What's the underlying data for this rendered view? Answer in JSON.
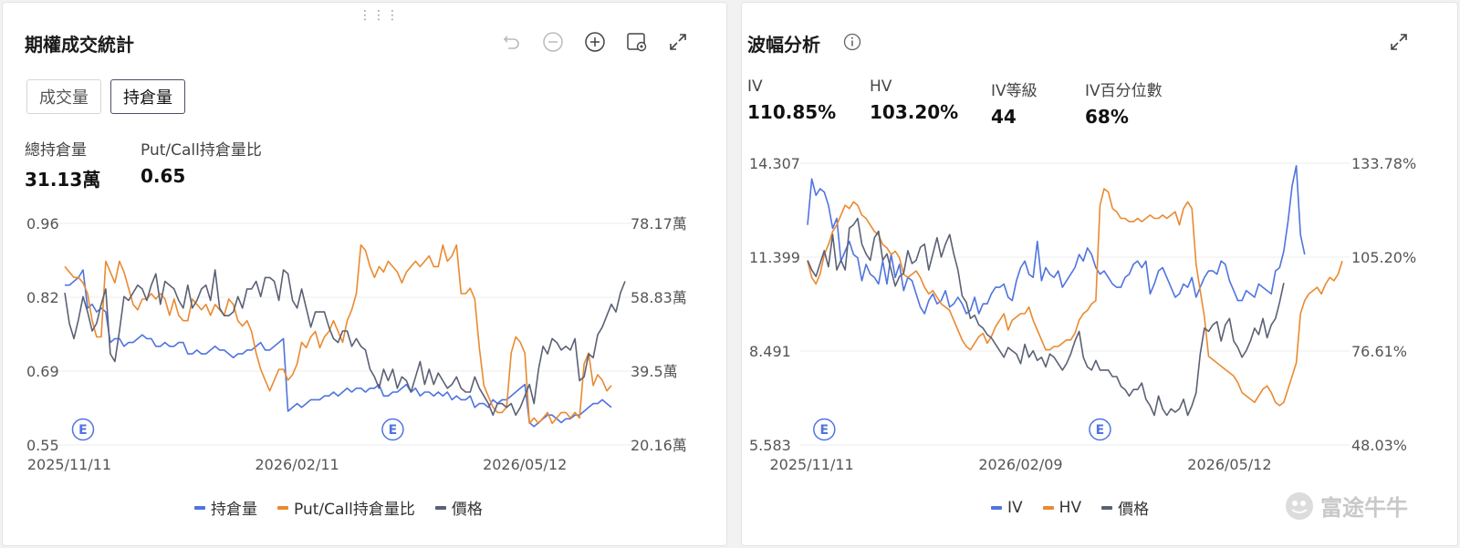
{
  "colors": {
    "blue": "#4f74df",
    "orange": "#ea8a30",
    "gray": "#5b6175",
    "grid": "#ececec",
    "axis_text": "#555555"
  },
  "panel1": {
    "title": "期權成交統計",
    "toolbar_icons": [
      "undo-icon",
      "zoom-out-icon",
      "zoom-in-icon",
      "screenshot-icon",
      "expand-icon"
    ],
    "tabs": [
      {
        "label": "成交量",
        "active": false
      },
      {
        "label": "持倉量",
        "active": true
      }
    ],
    "stats": [
      {
        "label": "總持倉量",
        "value": "31.13萬"
      },
      {
        "label": "Put/Call持倉量比",
        "value": "0.65"
      }
    ],
    "event_marker": "E"
  },
  "panel2": {
    "title": "波幅分析",
    "info_icon": "info-icon",
    "expand_icon": "expand-icon",
    "stats": [
      {
        "label": "IV",
        "value": "110.85%"
      },
      {
        "label": "HV",
        "value": "103.20%"
      },
      {
        "label": "IV等級",
        "value": "44"
      },
      {
        "label": "IV百分位數",
        "value": "68%"
      }
    ],
    "event_marker": "E"
  },
  "watermark": "富途牛牛",
  "chart_data": [
    {
      "type": "line",
      "left_axis": {
        "ticks": [
          "0.96",
          "0.82",
          "0.69",
          "0.55"
        ],
        "ylim": [
          0.55,
          0.96
        ]
      },
      "right_axis": {
        "ticks": [
          "78.17萬",
          "58.83萬",
          "39.5萬",
          "20.16萬"
        ],
        "ylim": [
          20.16,
          78.17
        ]
      },
      "x_ticks": [
        "2025/11/11",
        "2026/02/11",
        "2026/05/12"
      ],
      "x_tick_index": [
        1,
        51,
        101
      ],
      "events_index": [
        4,
        72
      ],
      "legend_position": "bottom",
      "series": [
        {
          "name": "持倉量",
          "axis": "right",
          "color": "blue",
          "values": [
            62,
            62,
            63,
            64,
            66,
            56,
            57,
            55,
            56,
            55,
            47,
            48,
            48,
            46,
            47,
            47,
            48,
            49,
            48,
            48,
            46,
            46,
            47,
            46,
            46,
            47,
            47,
            44,
            44,
            45,
            44,
            44,
            45,
            46,
            45,
            45,
            44,
            43,
            44,
            44,
            45,
            45,
            46,
            47,
            45,
            45,
            46,
            47,
            48,
            29,
            30,
            31,
            30,
            31,
            32,
            32,
            32,
            33,
            33,
            34,
            33,
            34,
            35,
            34,
            35,
            35,
            34,
            35,
            35,
            36,
            33,
            33,
            34,
            34,
            35,
            36,
            34,
            35,
            33,
            34,
            34,
            33,
            34,
            33,
            34,
            32,
            33,
            32,
            32,
            33,
            30,
            31,
            31,
            30,
            32,
            31,
            32,
            32,
            33,
            34,
            35,
            36,
            26,
            25,
            26,
            27,
            28,
            28,
            27,
            26,
            27,
            27,
            28,
            28,
            29,
            30,
            31,
            31,
            32,
            31,
            30
          ]
        },
        {
          "name": "Put/Call持倉量比",
          "axis": "left",
          "color": "orange",
          "values": [
            0.88,
            0.87,
            0.86,
            0.86,
            0.85,
            0.83,
            0.78,
            0.75,
            0.75,
            0.89,
            0.87,
            0.85,
            0.89,
            0.87,
            0.84,
            0.81,
            0.8,
            0.82,
            0.82,
            0.83,
            0.82,
            0.83,
            0.82,
            0.79,
            0.82,
            0.79,
            0.78,
            0.78,
            0.82,
            0.81,
            0.8,
            0.81,
            0.79,
            0.81,
            0.8,
            0.79,
            0.82,
            0.81,
            0.78,
            0.77,
            0.78,
            0.76,
            0.72,
            0.69,
            0.67,
            0.65,
            0.67,
            0.69,
            0.69,
            0.67,
            0.68,
            0.7,
            0.74,
            0.73,
            0.75,
            0.76,
            0.73,
            0.75,
            0.76,
            0.78,
            0.76,
            0.74,
            0.78,
            0.8,
            0.83,
            0.92,
            0.91,
            0.88,
            0.86,
            0.88,
            0.87,
            0.89,
            0.88,
            0.87,
            0.85,
            0.87,
            0.88,
            0.89,
            0.88,
            0.89,
            0.9,
            0.88,
            0.88,
            0.92,
            0.89,
            0.9,
            0.92,
            0.83,
            0.83,
            0.84,
            0.82,
            0.73,
            0.66,
            0.64,
            0.62,
            0.61,
            0.61,
            0.62,
            0.72,
            0.75,
            0.74,
            0.72,
            0.59,
            0.6,
            0.59,
            0.6,
            0.61,
            0.59,
            0.6,
            0.61,
            0.61,
            0.6,
            0.61,
            0.6,
            0.7,
            0.72,
            0.66,
            0.68,
            0.67,
            0.65,
            0.66
          ]
        },
        {
          "name": "價格",
          "axis": "right",
          "color": "gray",
          "values": [
            60,
            52,
            48,
            53,
            59,
            55,
            50,
            52,
            57,
            61,
            44,
            42,
            50,
            59,
            58,
            60,
            62,
            61,
            58,
            62,
            65,
            57,
            63,
            62,
            61,
            58,
            56,
            62,
            56,
            58,
            61,
            62,
            58,
            66,
            56,
            54,
            54,
            55,
            59,
            56,
            61,
            61,
            63,
            59,
            64,
            64,
            63,
            58,
            66,
            65,
            58,
            56,
            61,
            56,
            51,
            55,
            55,
            55,
            51,
            48,
            47,
            50,
            50,
            46,
            48,
            46,
            45,
            40,
            38,
            35,
            40,
            37,
            40,
            35,
            38,
            37,
            34,
            38,
            42,
            36,
            40,
            36,
            39,
            37,
            35,
            36,
            38,
            35,
            34,
            34,
            38,
            35,
            33,
            31,
            28,
            31,
            31,
            30,
            31,
            28,
            30,
            33,
            36,
            31,
            40,
            46,
            44,
            48,
            47,
            45,
            46,
            45,
            48,
            37,
            38,
            44,
            43,
            49,
            51,
            54,
            57,
            55,
            60,
            63
          ]
        }
      ]
    },
    {
      "type": "line",
      "left_axis": {
        "ticks": [
          "14.307",
          "11.399",
          "8.491",
          "5.583"
        ],
        "ylim": [
          5.583,
          14.307
        ]
      },
      "right_axis": {
        "ticks": [
          "133.78%",
          "105.20%",
          "76.61%",
          "48.03%"
        ],
        "ylim": [
          48.03,
          133.78
        ]
      },
      "x_ticks": [
        "2025/11/11",
        "2026/02/09",
        "2026/05/12"
      ],
      "x_tick_index": [
        1,
        51,
        101
      ],
      "events_index": [
        4,
        70
      ],
      "legend_position": "bottom",
      "series": [
        {
          "name": "IV",
          "axis": "right",
          "color": "blue",
          "values": [
            115,
            129,
            124,
            126,
            125,
            121,
            114,
            117,
            104,
            107,
            110,
            106,
            105,
            98,
            103,
            100,
            99,
            97,
            104,
            97,
            106,
            99,
            103,
            95,
            99,
            98,
            94,
            90,
            88,
            92,
            94,
            91,
            92,
            95,
            90,
            91,
            93,
            91,
            88,
            89,
            93,
            88,
            91,
            91,
            94,
            96,
            96,
            97,
            93,
            92,
            98,
            102,
            104,
            100,
            99,
            110,
            98,
            102,
            100,
            99,
            101,
            96,
            98,
            100,
            102,
            106,
            104,
            108,
            106,
            102,
            100,
            101,
            99,
            97,
            96,
            96,
            99,
            100,
            103,
            104,
            102,
            104,
            94,
            97,
            101,
            102,
            99,
            96,
            93,
            94,
            97,
            96,
            99,
            93,
            96,
            99,
            101,
            101,
            100,
            104,
            103,
            98,
            95,
            92,
            92,
            95,
            94,
            93,
            97,
            96,
            95,
            94,
            101,
            102,
            107,
            116,
            127,
            133,
            112,
            106
          ]
        },
        {
          "name": "HV",
          "axis": "right",
          "color": "orange",
          "values": [
            104,
            99,
            97,
            100,
            106,
            109,
            113,
            115,
            118,
            121,
            120,
            122,
            121,
            118,
            117,
            115,
            113,
            112,
            109,
            108,
            106,
            107,
            105,
            100,
            99,
            100,
            101,
            99,
            96,
            94,
            95,
            93,
            91,
            90,
            89,
            86,
            83,
            80,
            78,
            77,
            79,
            81,
            82,
            79,
            81,
            84,
            86,
            88,
            83,
            86,
            87,
            88,
            88,
            90,
            86,
            83,
            80,
            77,
            77,
            78,
            78,
            79,
            80,
            80,
            82,
            86,
            88,
            89,
            91,
            92,
            121,
            126,
            125,
            120,
            119,
            117,
            117,
            116,
            116,
            117,
            116,
            117,
            118,
            117,
            117,
            118,
            117,
            118,
            119,
            115,
            120,
            122,
            120,
            103,
            95,
            87,
            75,
            74,
            73,
            72,
            71,
            70,
            69,
            67,
            64,
            63,
            62,
            61,
            63,
            65,
            66,
            64,
            61,
            60,
            61,
            65,
            69,
            73,
            88,
            92,
            94,
            95,
            96,
            94,
            97,
            99,
            98,
            100,
            104
          ]
        },
        {
          "name": "價格",
          "axis": "left",
          "color": "gray",
          "values": [
            11.3,
            11.0,
            10.8,
            11.2,
            11.6,
            11.1,
            12.1,
            11.0,
            11.3,
            11.0,
            12.3,
            12.4,
            12.6,
            11.8,
            11.5,
            11.3,
            12.0,
            12.2,
            11.3,
            11.5,
            11.0,
            10.5,
            10.8,
            10.9,
            11.6,
            11.2,
            11.3,
            11.7,
            11.8,
            11.0,
            11.5,
            12.0,
            11.4,
            11.8,
            12.1,
            11.5,
            11.0,
            10.2,
            10.0,
            9.5,
            9.6,
            9.3,
            9.2,
            9.0,
            8.9,
            8.7,
            8.5,
            8.3,
            8.6,
            8.5,
            8.4,
            8.1,
            8.7,
            8.3,
            8.5,
            8.2,
            8.3,
            8.0,
            8.4,
            8.3,
            8.1,
            7.9,
            8.1,
            8.4,
            8.8,
            9.1,
            8.3,
            8.0,
            7.9,
            8.2,
            7.9,
            7.9,
            7.9,
            7.7,
            7.7,
            7.4,
            7.3,
            7.1,
            7.3,
            7.3,
            7.5,
            7.0,
            6.8,
            6.5,
            7.1,
            6.7,
            6.5,
            6.7,
            6.6,
            6.7,
            7.0,
            6.5,
            6.8,
            7.2,
            8.4,
            9.2,
            9.1,
            9.3,
            9.4,
            8.8,
            9.3,
            9.5,
            8.8,
            8.6,
            8.3,
            8.5,
            8.8,
            9.2,
            9.0,
            9.5,
            8.9,
            9.3,
            9.5,
            10.0,
            10.6
          ]
        }
      ]
    }
  ]
}
